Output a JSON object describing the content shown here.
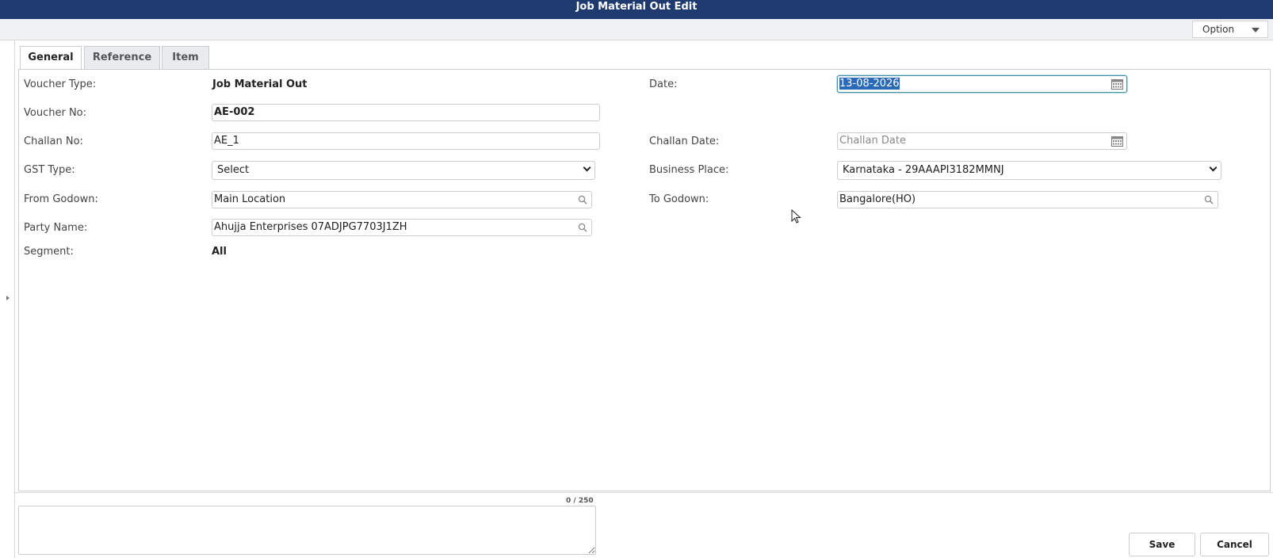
{
  "window": {
    "title": "Job Material Out Edit"
  },
  "toolbar": {
    "option_label": "Option"
  },
  "tabs": [
    {
      "label": "General",
      "active": true
    },
    {
      "label": "Reference",
      "active": false
    },
    {
      "label": "Item",
      "active": false
    }
  ],
  "form": {
    "voucher_type": {
      "label": "Voucher Type:",
      "value": "Job Material Out"
    },
    "voucher_no": {
      "label": "Voucher No:",
      "value": "AE-002"
    },
    "challan_no": {
      "label": "Challan No:",
      "value": "AE_1"
    },
    "gst_type": {
      "label": "GST Type:",
      "value": "Select"
    },
    "from_godown": {
      "label": "From Godown:",
      "value": "Main Location"
    },
    "party_name": {
      "label": "Party Name:",
      "value": "Ahujja Enterprises 07ADJPG7703J1ZH"
    },
    "segment": {
      "label": "Segment:",
      "value": "All"
    },
    "date": {
      "label": "Date:",
      "value": "13-08-2026"
    },
    "challan_date": {
      "label": "Challan Date:",
      "placeholder": "Challan Date"
    },
    "business_place": {
      "label": "Business Place:",
      "value": "Karnataka -  29AAAPI3182MMNJ"
    },
    "to_godown": {
      "label": "To Godown:",
      "value": "Bangalore(HO)"
    }
  },
  "notes": {
    "counter": "0 / 250"
  },
  "actions": {
    "save_label": "Save",
    "cancel_label": "Cancel"
  }
}
